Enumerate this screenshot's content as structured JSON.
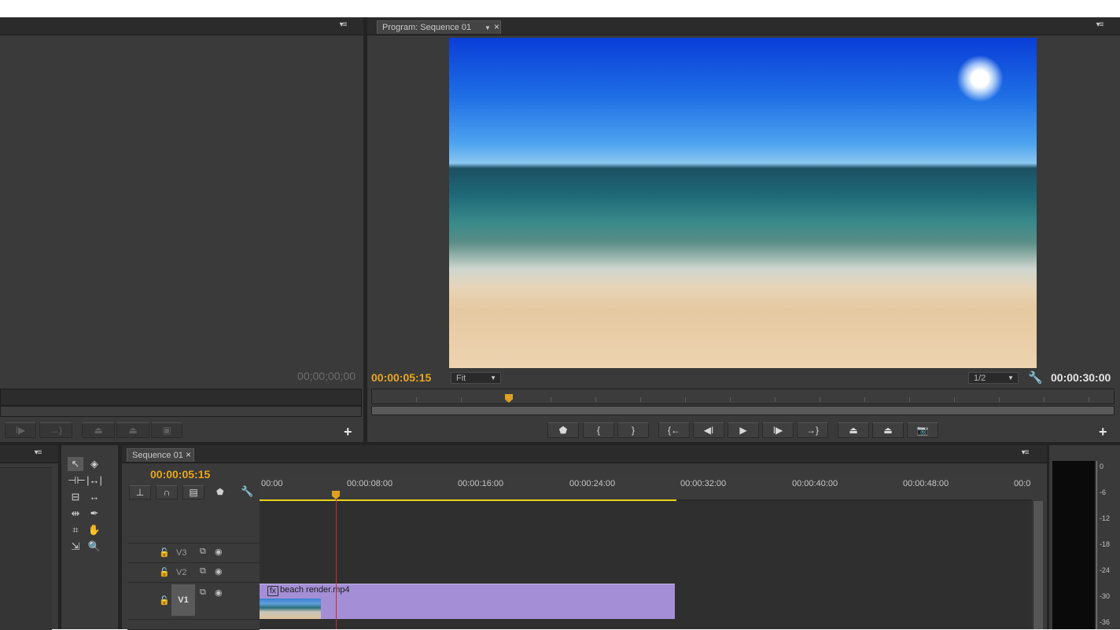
{
  "source_monitor": {
    "timecode": "00;00;00;00"
  },
  "program_monitor": {
    "tab_title": "Program: Sequence 01",
    "tab_dropdown_icon": "chevron-down-icon",
    "tab_close": "×",
    "current_timecode": "00:00:05:15",
    "zoom_select": "Fit",
    "resolution_select": "1/2",
    "duration_timecode": "00:00:30:00",
    "controls": [
      {
        "name": "add-marker-button",
        "glyph": "⬟"
      },
      {
        "name": "mark-in-button",
        "glyph": "{"
      },
      {
        "name": "mark-out-button",
        "glyph": "}"
      },
      {
        "name": "go-to-in-button",
        "glyph": "{←"
      },
      {
        "name": "step-back-button",
        "glyph": "◀I"
      },
      {
        "name": "play-button",
        "glyph": "▶"
      },
      {
        "name": "step-forward-button",
        "glyph": "I▶"
      },
      {
        "name": "go-to-out-button",
        "glyph": "→}"
      },
      {
        "name": "lift-button",
        "glyph": "⏏"
      },
      {
        "name": "extract-button",
        "glyph": "⏏"
      },
      {
        "name": "export-frame-button",
        "glyph": "📷"
      }
    ],
    "add_button": "+"
  },
  "source_controls": {
    "add_button": "+"
  },
  "timeline": {
    "tab_title": "Sequence 01",
    "tab_close": "×",
    "current_timecode": "00:00:05:15",
    "ruler_labels": [
      "00:00",
      "00:00:08:00",
      "00:00:16:00",
      "00:00:24:00",
      "00:00:32:00",
      "00:00:40:00",
      "00:00:48:00",
      "00:0"
    ],
    "tracks": [
      {
        "label": "V3"
      },
      {
        "label": "V2"
      },
      {
        "label": "V1"
      }
    ],
    "clip": {
      "name": "beach render.mp4",
      "fx_badge": "fx",
      "color": "#a48fd6"
    }
  },
  "audio_meter": {
    "ticks": [
      "0",
      "-6",
      "-12",
      "-18",
      "-24",
      "-30",
      "-36"
    ]
  },
  "colors": {
    "accent_timecode": "#e8a61c",
    "panel_bg": "#3a3a3a",
    "playhead_line": "#c03030"
  }
}
